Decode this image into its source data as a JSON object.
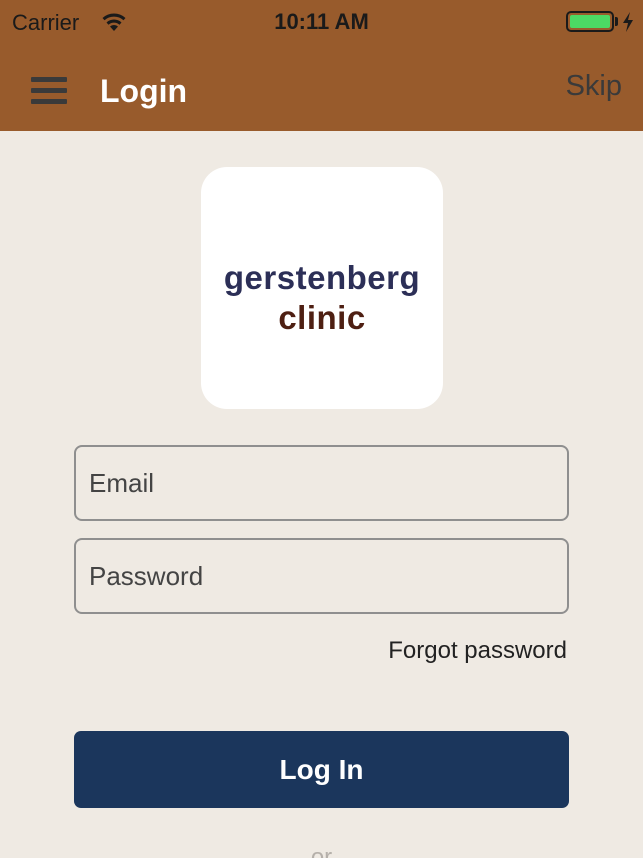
{
  "status_bar": {
    "carrier": "Carrier",
    "time": "10:11 AM",
    "battery_color": "#4cd964"
  },
  "nav": {
    "menu_icon": "hamburger-menu-icon",
    "title": "Login",
    "skip_label": "Skip",
    "background_color": "#985b2c"
  },
  "logo": {
    "line1": "gerstenberg",
    "line2": "clinic"
  },
  "form": {
    "email_placeholder": "Email",
    "password_placeholder": "Password",
    "forgot_label": "Forgot password",
    "login_label": "Log In",
    "login_color": "#1b365c",
    "divider_text": "or"
  }
}
